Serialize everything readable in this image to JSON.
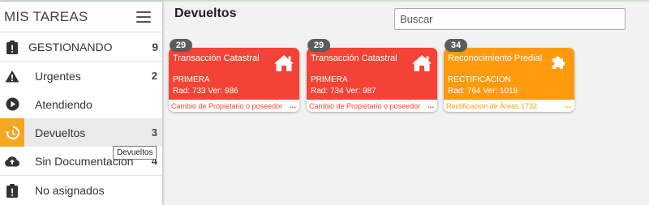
{
  "sidebar": {
    "title": "MIS TAREAS",
    "items": [
      {
        "label": "GESTIONANDO",
        "count": "9",
        "icon": "clipboard-alert-icon"
      },
      {
        "label": "Urgentes",
        "count": "2",
        "icon": "warning-icon"
      },
      {
        "label": "Atendiendo",
        "count": "",
        "icon": "play-circle-icon"
      },
      {
        "label": "Devueltos",
        "count": "3",
        "icon": "history-icon"
      },
      {
        "label": "Sin Documentacion",
        "count": "4",
        "icon": "cloud-upload-icon"
      },
      {
        "label": "No asignados",
        "count": "",
        "icon": "clipboard-alert-icon"
      }
    ],
    "tooltip": "Devueltos"
  },
  "main": {
    "title": "Devueltos",
    "search_placeholder": "Buscar"
  },
  "cards": [
    {
      "badge": "29",
      "title": "Transacción Catastral",
      "line1": "PRIMERA",
      "line2": "Rad: 733 Ver: 986",
      "footer": "Cambio de Propietario o poseedor",
      "dots": "...",
      "icon": "home-icon",
      "color": "#f44336"
    },
    {
      "badge": "29",
      "title": "Transacción Catastral",
      "line1": "PRIMERA",
      "line2": "Rad: 734 Ver: 987",
      "footer": "Cambio de Propietario o poseedor",
      "dots": "...",
      "icon": "home-icon",
      "color": "#f44336"
    },
    {
      "badge": "34",
      "title": "Reconocimiento Predial",
      "line1": "RECTIFICACIÓN",
      "line2": "Rad: 764 Ver: 1018",
      "footer": "Rectificacion de Áreas 1732",
      "dots": "...",
      "icon": "puzzle-icon",
      "color": "#ff9a0e"
    }
  ],
  "colors": {
    "active_accent": "#f5a623",
    "red_card": "#f44336",
    "orange_card": "#ff9a0e",
    "badge": "#5c5c5c"
  }
}
